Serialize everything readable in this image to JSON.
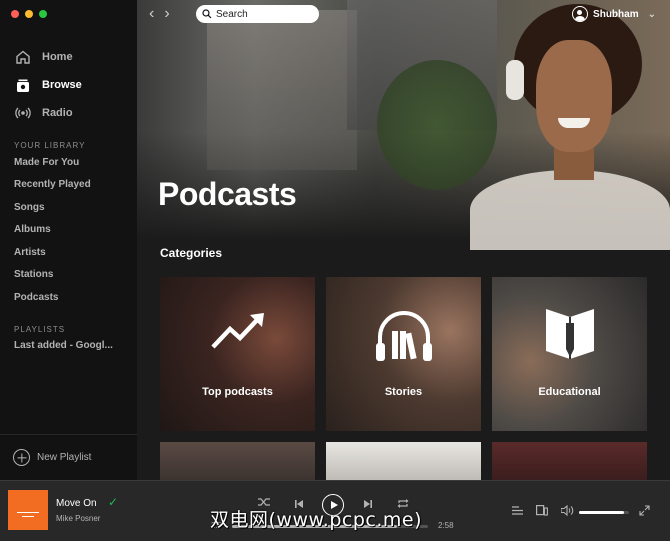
{
  "sidebar": {
    "main_nav": [
      {
        "label": "Home",
        "icon": "home-icon"
      },
      {
        "label": "Browse",
        "icon": "browse-icon",
        "active": true
      },
      {
        "label": "Radio",
        "icon": "radio-icon"
      }
    ],
    "library_title": "YOUR LIBRARY",
    "library_items": [
      "Made For You",
      "Recently Played",
      "Songs",
      "Albums",
      "Artists",
      "Stations",
      "Podcasts"
    ],
    "playlists_title": "PLAYLISTS",
    "playlists": [
      "Last added - Googl..."
    ],
    "new_playlist_label": "New Playlist"
  },
  "header": {
    "back_icon": "chevron-left-icon",
    "forward_icon": "chevron-right-icon",
    "search_placeholder": "Search",
    "user_name": "Shubham"
  },
  "page": {
    "title": "Podcasts",
    "categories_title": "Categories",
    "categories": [
      {
        "label": "Top podcasts",
        "icon": "trending-up-icon"
      },
      {
        "label": "Stories",
        "icon": "headphones-books-icon"
      },
      {
        "label": "Educational",
        "icon": "open-book-icon"
      }
    ]
  },
  "player": {
    "track_name": "Move On",
    "artist": "Mike Posner",
    "elapsed": "2:5",
    "duration": "2:58",
    "progress_fraction": 0.84,
    "volume_fraction": 0.9
  },
  "watermark": "双电网(www.pcpc.me)",
  "colors": {
    "sidebar_bg": "#121212",
    "main_bg": "#1b1b1b",
    "player_bg": "#282828",
    "accent_green": "#1db954",
    "cover_orange": "#f26d21"
  }
}
